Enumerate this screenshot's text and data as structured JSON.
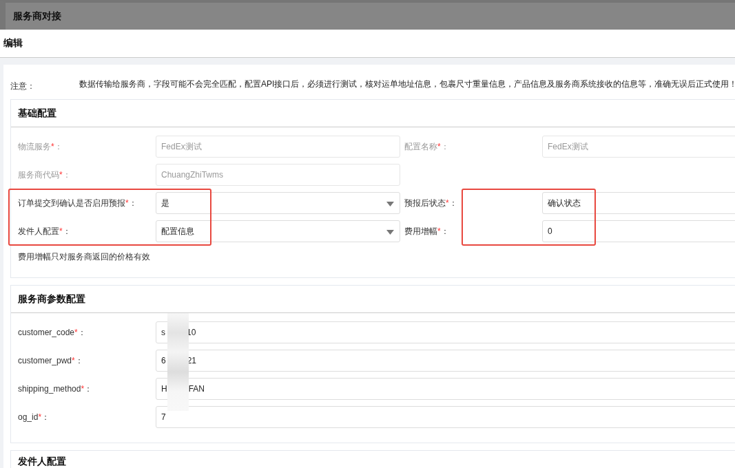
{
  "page_title": "服务商对接",
  "edit_header": "编辑",
  "notice": {
    "label": "注意：",
    "text": "数据传输给服务商，字段可能不会完全匹配，配置API接口后，必须进行测试，核对运单地址信息，包裹尺寸重量信息，产品信息及服务商系统接收的信息等，准确无误后正式使用！"
  },
  "basic_section": {
    "title": "基础配置",
    "rows": [
      {
        "highlighted": false,
        "fields": [
          {
            "label": "物流服务",
            "mark": "*",
            "colon": "：",
            "kind": "input",
            "value": "FedEx测试",
            "disabled": true
          },
          {
            "label": "配置名称",
            "mark": "*",
            "colon": "：",
            "kind": "input",
            "value": "FedEx测试",
            "disabled": true
          }
        ]
      },
      {
        "highlighted": false,
        "fields": [
          {
            "label": "服务商代码",
            "mark": "*",
            "colon": "：",
            "kind": "input",
            "value": "ChuangZhiTwms",
            "disabled": true
          }
        ]
      },
      {
        "highlighted": true,
        "fields": [
          {
            "label": "订单提交到确认是否启用预报",
            "mark": "*",
            "colon": "：",
            "kind": "select",
            "value": "是",
            "disabled": false
          },
          {
            "label": "预报后状态",
            "mark": "*",
            "colon": "：",
            "kind": "input",
            "value": "确认状态",
            "disabled": false
          }
        ]
      },
      {
        "highlighted": true,
        "fields": [
          {
            "label": "发件人配置",
            "mark": "*",
            "colon": "：",
            "kind": "select",
            "value": "配置信息",
            "disabled": false
          },
          {
            "label": "费用增幅",
            "mark": "*",
            "colon": "：",
            "kind": "input",
            "value": "0",
            "disabled": false
          }
        ]
      }
    ],
    "hint": "费用增幅只对服务商返回的价格有效"
  },
  "param_section": {
    "title": "服务商参数配置",
    "rows": [
      {
        "label": "customer_code",
        "mark": "*",
        "colon": "：",
        "value_parts": [
          "s",
          "10"
        ]
      },
      {
        "label": "customer_pwd",
        "mark": "*",
        "colon": "：",
        "value_parts": [
          "6",
          "21"
        ]
      },
      {
        "label": "shipping_method",
        "mark": "*",
        "colon": "：",
        "value_parts": [
          "H",
          "FAN"
        ]
      },
      {
        "label": "og_id",
        "mark": "*",
        "colon": "：",
        "value_parts": [
          "7"
        ]
      }
    ]
  },
  "sender_section": {
    "title": "发件人配置"
  }
}
